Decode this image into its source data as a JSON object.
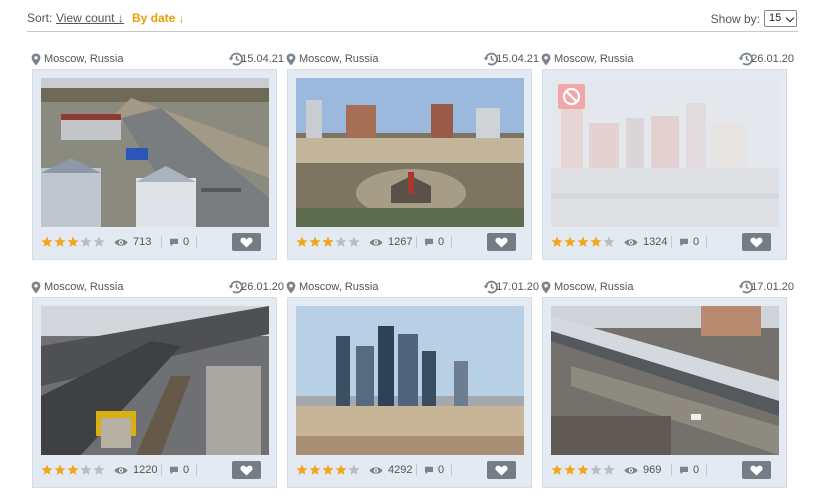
{
  "sort": {
    "label": "Sort:",
    "view_count": "View count ↓",
    "by_date": "By date ↓"
  },
  "show_by": {
    "label": "Show by:",
    "value": "15"
  },
  "colors": {
    "accent": "#e8a000",
    "star_on": "#f2a61d",
    "star_off": "#b9bec4",
    "like_bg": "#747c85",
    "blocked_badge": "#f2a7a7"
  },
  "cameras": [
    {
      "location": "Moscow, Russia",
      "date": "15.04.21",
      "rating": 3,
      "views": "713",
      "comments": "0",
      "blocked": false
    },
    {
      "location": "Moscow, Russia",
      "date": "15.04.21",
      "rating": 3,
      "views": "1267",
      "comments": "0",
      "blocked": false
    },
    {
      "location": "Moscow, Russia",
      "date": "26.01.20",
      "rating": 4,
      "views": "1324",
      "comments": "0",
      "blocked": true
    },
    {
      "location": "Moscow, Russia",
      "date": "26.01.20",
      "rating": 3,
      "views": "1220",
      "comments": "0",
      "blocked": false
    },
    {
      "location": "Moscow, Russia",
      "date": "17.01.20",
      "rating": 4,
      "views": "4292",
      "comments": "0",
      "blocked": false
    },
    {
      "location": "Moscow, Russia",
      "date": "17.01.20",
      "rating": 3,
      "views": "969",
      "comments": "0",
      "blocked": false
    }
  ],
  "icons": {
    "location": "map-pin-icon",
    "date": "clock-icon",
    "views": "eye-icon",
    "comments": "comment-icon",
    "like": "heart-icon",
    "blocked": "blocked-icon"
  }
}
